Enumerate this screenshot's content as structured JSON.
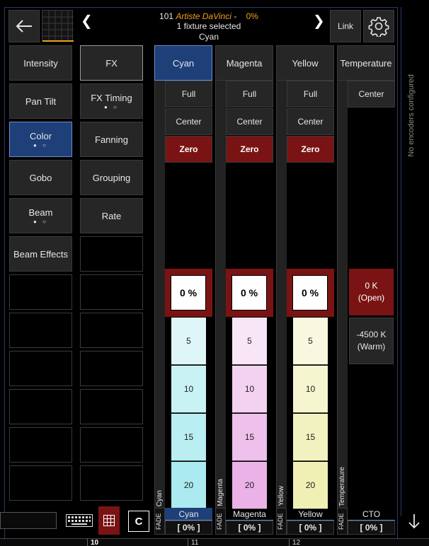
{
  "header": {
    "fixture_number": "101",
    "fixture_name": "Artiste DaVinci",
    "separator": "-",
    "intensity": "0%",
    "selection_text": "1 fixture selected",
    "attribute_text": "Cyan",
    "link_label": "Link"
  },
  "left_column": [
    {
      "label": "Intensity",
      "state": "normal"
    },
    {
      "label": "Pan Tilt",
      "state": "normal"
    },
    {
      "label": "Color",
      "state": "active",
      "dots": "● ○"
    },
    {
      "label": "Gobo",
      "state": "normal"
    },
    {
      "label": "Beam",
      "state": "normal",
      "dots": "● ○"
    },
    {
      "label": "Beam Effects",
      "state": "normal"
    }
  ],
  "right_column": [
    {
      "label": "FX",
      "state": "selected"
    },
    {
      "label": "FX Timing",
      "state": "normal",
      "dots": "● ○"
    },
    {
      "label": "Fanning",
      "state": "normal"
    },
    {
      "label": "Grouping",
      "state": "normal"
    },
    {
      "label": "Rate",
      "state": "normal"
    }
  ],
  "channels": [
    {
      "name": "Cyan",
      "strip_label": "Cyan",
      "full": "Full",
      "center": "Center",
      "zero": "Zero",
      "value": "0 %",
      "scale": [
        "5",
        "10",
        "15",
        "20"
      ],
      "fade_label": "FADE",
      "fade_name": "Cyan",
      "fade_value": "[ 0% ]",
      "tint": [
        "#dff6f8",
        "#c9f2f5",
        "#b9eef2",
        "#aaeaf0"
      ]
    },
    {
      "name": "Magenta",
      "strip_label": "Magenta",
      "full": "Full",
      "center": "Center",
      "zero": "Zero",
      "value": "0 %",
      "scale": [
        "5",
        "10",
        "15",
        "20"
      ],
      "fade_label": "FADE",
      "fade_name": "Magenta",
      "fade_value": "[ 0% ]",
      "tint": [
        "#f8e6f6",
        "#f3d1f0",
        "#eec0eb",
        "#ebb2e8"
      ]
    },
    {
      "name": "Yellow",
      "strip_label": "Yellow",
      "full": "Full",
      "center": "Center",
      "zero": "Zero",
      "value": "0 %",
      "scale": [
        "5",
        "10",
        "15",
        "20"
      ],
      "fade_label": "FADE",
      "fade_name": "Yellow",
      "fade_value": "[ 0% ]",
      "tint": [
        "#f8f8e0",
        "#f5f5cf",
        "#f2f2c0",
        "#f0f0b4"
      ]
    }
  ],
  "temperature": {
    "name": "Temperature",
    "strip_label": "Temperature",
    "center": "Center",
    "open_value": "0 K",
    "open_label": "(Open)",
    "warm_value": "-4500 K",
    "warm_label": "(Warm)",
    "fade_label": "FADE",
    "fade_name": "CTO",
    "fade_value": "[ 0% ]"
  },
  "encoder_message": "No encoders configured",
  "bottom": {
    "clear_label": "C",
    "page_numbers": [
      "10",
      "11",
      "12"
    ]
  },
  "colors": {
    "accent_blue": "#1e3f78",
    "zero_red": "#7a1414",
    "fixture_orange": "#f0a020"
  }
}
